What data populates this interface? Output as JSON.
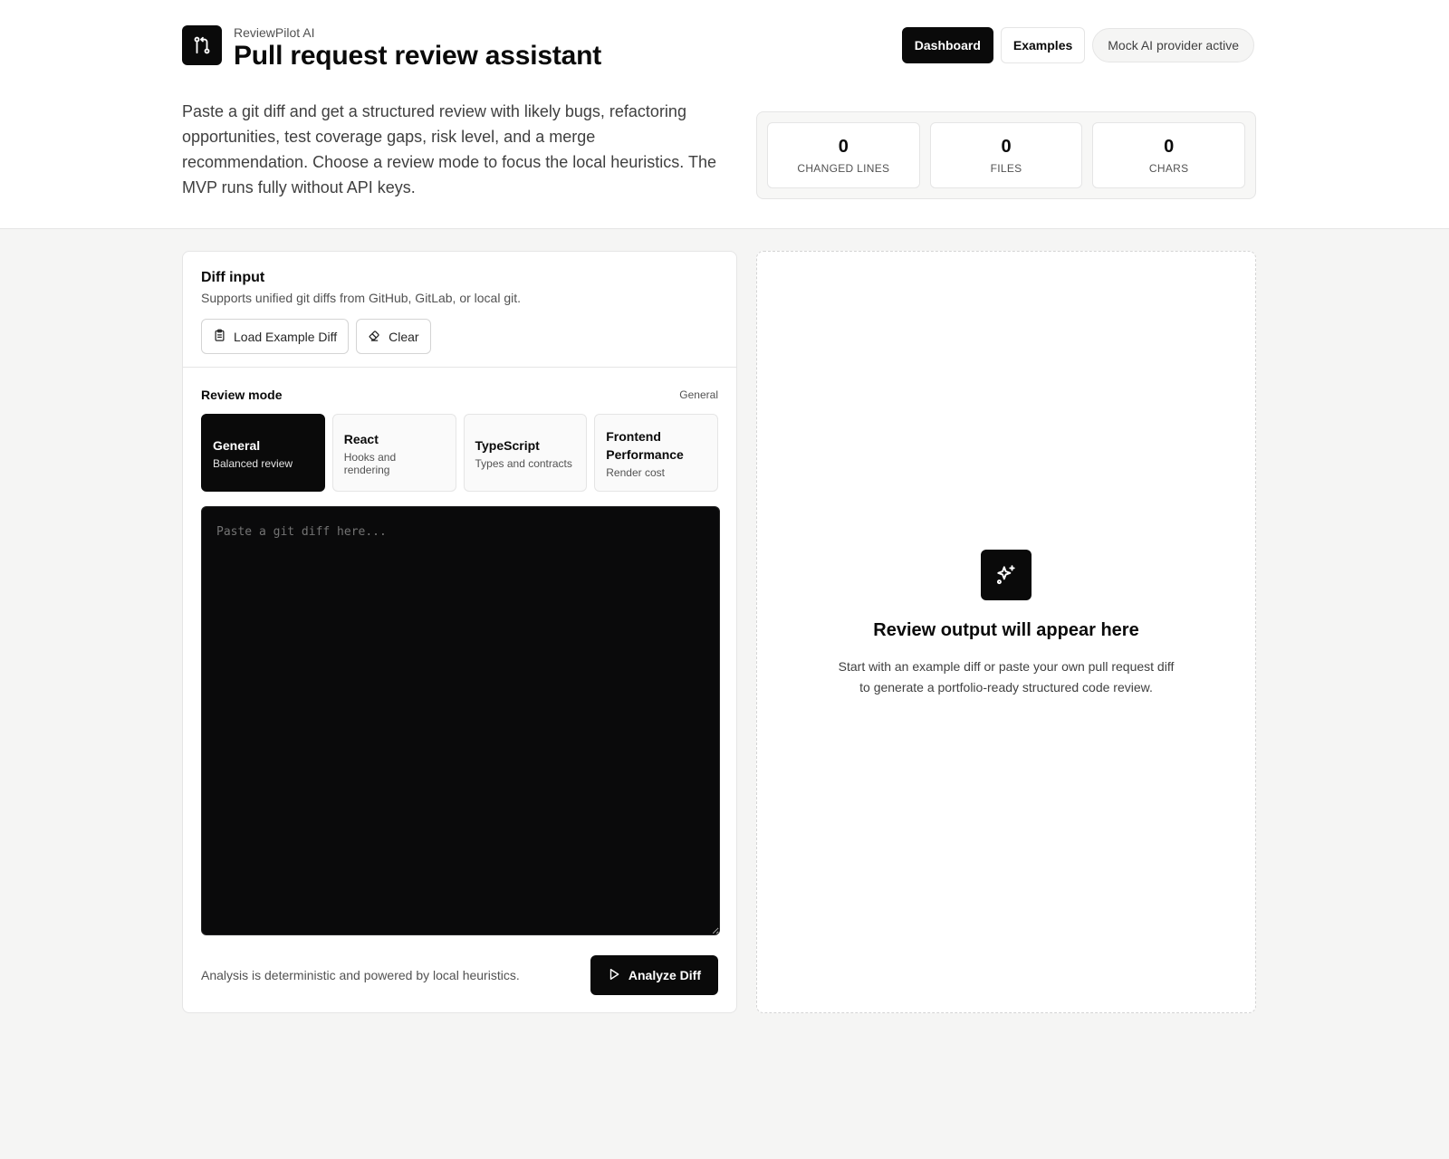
{
  "header": {
    "brand_name": "ReviewPilot AI",
    "title": "Pull request review assistant",
    "logo_icon": "git-pull-request-icon",
    "intro": "Paste a git diff and get a structured review with likely bugs, refactoring opportunities, test coverage gaps, risk level, and a merge recommendation. Choose a review mode to focus the local heuristics. The MVP runs fully without API keys."
  },
  "nav": {
    "dashboard": "Dashboard",
    "examples": "Examples",
    "provider_status": "Mock AI provider active"
  },
  "stats": [
    {
      "value": "0",
      "label": "CHANGED LINES"
    },
    {
      "value": "0",
      "label": "FILES"
    },
    {
      "value": "0",
      "label": "CHARS"
    }
  ],
  "diff_input": {
    "title": "Diff input",
    "subtitle": "Supports unified git diffs from GitHub, GitLab, or local git.",
    "load_example_label": "Load Example Diff",
    "clear_label": "Clear",
    "placeholder": "Paste a git diff here...",
    "value": ""
  },
  "review_mode": {
    "title": "Review mode",
    "current": "General",
    "modes": [
      {
        "name": "General",
        "desc": "Balanced review",
        "active": true
      },
      {
        "name": "React",
        "desc": "Hooks and rendering",
        "active": false
      },
      {
        "name": "TypeScript",
        "desc": "Types and contracts",
        "active": false
      },
      {
        "name": "Frontend Performance",
        "desc": "Render cost",
        "active": false
      }
    ]
  },
  "footer": {
    "note": "Analysis is deterministic and powered by local heuristics.",
    "analyze_label": "Analyze Diff"
  },
  "output": {
    "icon": "sparkles-icon",
    "title": "Review output will appear here",
    "description": "Start with an example diff or paste your own pull request diff to generate a portfolio-ready structured code review."
  },
  "colors": {
    "accent": "#0a0a0a",
    "background": "#f5f5f4",
    "surface": "#ffffff",
    "border": "#e5e5e5",
    "editor_bg": "#0a0a0b"
  }
}
